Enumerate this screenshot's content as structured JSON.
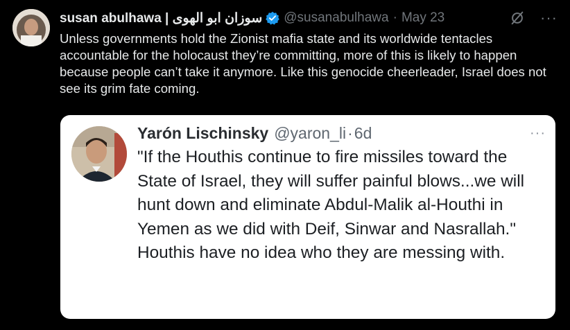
{
  "tweet": {
    "author_name": "susan abulhawa | سوزان ابو الهوى",
    "handle": "@susanabulhawa",
    "separator": "·",
    "date": "May 23",
    "text": "Unless governments hold the Zionist mafia state and its worldwide tentacles accountable for the holocaust they’re committing, more of this is likely to happen because people can’t take it anymore. Like this genocide cheerleader, Israel does not see its grim fate coming.",
    "icons": {
      "verified": "verified-badge-icon",
      "grok": "grok-icon",
      "more": "more-options-icon"
    },
    "more_glyph": "···"
  },
  "quote": {
    "author_name": "Yarón Lischinsky",
    "handle": "@yaron_li",
    "separator": "·",
    "age": "6d",
    "more_glyph": "···",
    "paragraphs": [
      "\"If the Houthis continue to fire missiles toward the State of Israel, they will suffer painful blows...we will hunt down and eliminate Abdul-Malik al-Houthi in Yemen as we did with Deif, Sinwar and Nasrallah.\"",
      "Houthis have no idea who they are messing with."
    ]
  },
  "colors": {
    "background": "#000000",
    "text": "#e7e9ea",
    "secondary": "#71767b",
    "verified": "#1d9bf0",
    "quote_background": "#ffffff"
  }
}
